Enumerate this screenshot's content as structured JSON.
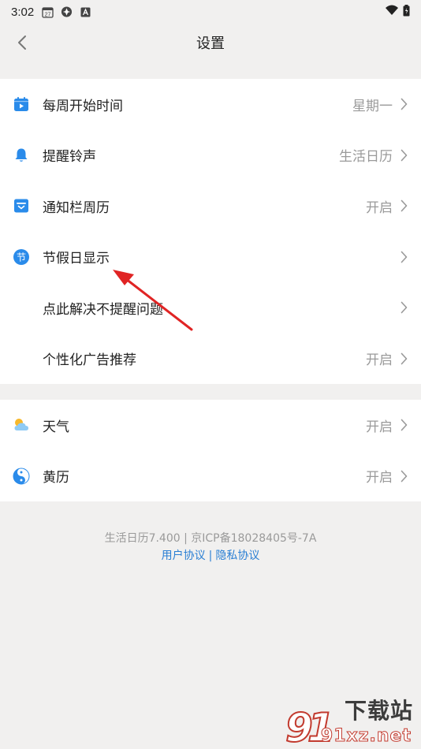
{
  "statusbar": {
    "time": "3:02",
    "calendar_badge": "27",
    "icons": [
      "calendar-icon",
      "app-icon",
      "a-icon",
      "wifi-icon",
      "battery-icon"
    ]
  },
  "header": {
    "title": "设置",
    "back_icon": "chevron-left-icon"
  },
  "section1": [
    {
      "icon": "calendar-play-icon",
      "label": "每周开始时间",
      "value": "星期一"
    },
    {
      "icon": "bell-icon",
      "label": "提醒铃声",
      "value": "生活日历"
    },
    {
      "icon": "notification-calendar-icon",
      "label": "通知栏周历",
      "value": "开启"
    },
    {
      "icon": "holiday-icon",
      "icon_text": "节",
      "label": "节假日显示",
      "value": ""
    },
    {
      "icon": "",
      "label": "点此解决不提醒问题",
      "value": ""
    },
    {
      "icon": "",
      "label": "个性化广告推荐",
      "value": "开启"
    }
  ],
  "section2": [
    {
      "icon": "weather-icon",
      "label": "天气",
      "value": "开启"
    },
    {
      "icon": "almanac-icon",
      "label": "黄历",
      "value": "开启"
    }
  ],
  "footer": {
    "version": "生活日历7.400 | 京ICP备18028405号-7A",
    "user_agreement": "用户协议",
    "separator": "|",
    "privacy_policy": "隐私协议"
  },
  "watermark": {
    "line1": "下载站",
    "line2": "91xz.net"
  },
  "colors": {
    "accent_blue": "#2a8bea",
    "link_blue": "#2a7fd4",
    "bell_blue": "#2a8bea",
    "annotation_red": "#e02424",
    "background": "#f1f0ef"
  }
}
